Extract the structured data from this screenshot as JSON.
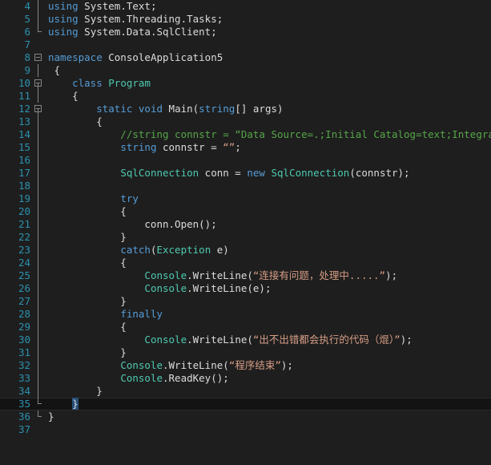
{
  "editor": {
    "name": "visual-studio-code-editor",
    "theme": "dark",
    "background_color": "#1e1e1e",
    "line_number_color": "#2b91af",
    "current_line": 35,
    "current_line_bg": "#131313",
    "selection_color": "#264f78",
    "colors": {
      "keyword": "#569cd6",
      "type": "#4ec9b0",
      "string": "#d69d85",
      "comment": "#57a64a",
      "plain": "#dcdcdc",
      "fold_marker": "#868686"
    },
    "lines": [
      {
        "number": "4",
        "fold": "guide",
        "tokens": [
          {
            "t": "using",
            "c": "kw"
          },
          {
            "t": " System.Text;",
            "c": "txt"
          }
        ]
      },
      {
        "number": "5",
        "fold": "guide",
        "tokens": [
          {
            "t": "using",
            "c": "kw"
          },
          {
            "t": " System.Threading.Tasks;",
            "c": "txt"
          }
        ]
      },
      {
        "number": "6",
        "fold": "guide-end",
        "tokens": [
          {
            "t": "using",
            "c": "kw"
          },
          {
            "t": " System.Data.SqlClient;",
            "c": "txt"
          }
        ]
      },
      {
        "number": "7",
        "fold": "none",
        "tokens": []
      },
      {
        "number": "8",
        "fold": "box",
        "tokens": [
          {
            "t": "namespace",
            "c": "kw"
          },
          {
            "t": " ConsoleApplication5",
            "c": "txt"
          }
        ]
      },
      {
        "number": "9",
        "fold": "guide",
        "tokens": [
          {
            "t": " {",
            "c": "txt"
          }
        ]
      },
      {
        "number": "10",
        "fold": "box-guide",
        "tokens": [
          {
            "t": "    ",
            "c": "txt"
          },
          {
            "t": "class",
            "c": "kw"
          },
          {
            "t": " ",
            "c": "txt"
          },
          {
            "t": "Program",
            "c": "type"
          }
        ]
      },
      {
        "number": "11",
        "fold": "guide",
        "tokens": [
          {
            "t": "    {",
            "c": "txt"
          }
        ]
      },
      {
        "number": "12",
        "fold": "box-guide",
        "tokens": [
          {
            "t": "        ",
            "c": "txt"
          },
          {
            "t": "static",
            "c": "kw"
          },
          {
            "t": " ",
            "c": "txt"
          },
          {
            "t": "void",
            "c": "kw"
          },
          {
            "t": " Main(",
            "c": "txt"
          },
          {
            "t": "string",
            "c": "kw"
          },
          {
            "t": "[] args)",
            "c": "txt"
          }
        ]
      },
      {
        "number": "13",
        "fold": "guide",
        "tokens": [
          {
            "t": "        {",
            "c": "txt"
          }
        ]
      },
      {
        "number": "14",
        "fold": "guide",
        "tokens": [
          {
            "t": "            //string connstr = “Data Source=.;Initial Catalog=text;Integrated Se",
            "c": "cmt"
          }
        ]
      },
      {
        "number": "15",
        "fold": "guide",
        "tokens": [
          {
            "t": "            ",
            "c": "txt"
          },
          {
            "t": "string",
            "c": "kw"
          },
          {
            "t": " connstr = ",
            "c": "txt"
          },
          {
            "t": "“”",
            "c": "str"
          },
          {
            "t": ";",
            "c": "txt"
          }
        ]
      },
      {
        "number": "16",
        "fold": "guide",
        "tokens": []
      },
      {
        "number": "17",
        "fold": "guide",
        "tokens": [
          {
            "t": "            ",
            "c": "txt"
          },
          {
            "t": "SqlConnection",
            "c": "type"
          },
          {
            "t": " conn = ",
            "c": "txt"
          },
          {
            "t": "new",
            "c": "kw"
          },
          {
            "t": " ",
            "c": "txt"
          },
          {
            "t": "SqlConnection",
            "c": "type"
          },
          {
            "t": "(connstr);",
            "c": "txt"
          }
        ]
      },
      {
        "number": "18",
        "fold": "guide",
        "tokens": []
      },
      {
        "number": "19",
        "fold": "guide",
        "tokens": [
          {
            "t": "            ",
            "c": "txt"
          },
          {
            "t": "try",
            "c": "kw"
          }
        ]
      },
      {
        "number": "20",
        "fold": "guide",
        "tokens": [
          {
            "t": "            {",
            "c": "txt"
          }
        ]
      },
      {
        "number": "21",
        "fold": "guide",
        "tokens": [
          {
            "t": "                conn.Open();",
            "c": "txt"
          }
        ]
      },
      {
        "number": "22",
        "fold": "guide",
        "tokens": [
          {
            "t": "            }",
            "c": "txt"
          }
        ]
      },
      {
        "number": "23",
        "fold": "guide",
        "tokens": [
          {
            "t": "            ",
            "c": "txt"
          },
          {
            "t": "catch",
            "c": "kw"
          },
          {
            "t": "(",
            "c": "txt"
          },
          {
            "t": "Exception",
            "c": "type"
          },
          {
            "t": " e)",
            "c": "txt"
          }
        ]
      },
      {
        "number": "24",
        "fold": "guide",
        "tokens": [
          {
            "t": "            {",
            "c": "txt"
          }
        ]
      },
      {
        "number": "25",
        "fold": "guide",
        "tokens": [
          {
            "t": "                ",
            "c": "txt"
          },
          {
            "t": "Console",
            "c": "type"
          },
          {
            "t": ".WriteLine(",
            "c": "txt"
          },
          {
            "t": "“连接有问题，处理中.....”",
            "c": "str"
          },
          {
            "t": ");",
            "c": "txt"
          }
        ]
      },
      {
        "number": "26",
        "fold": "guide",
        "tokens": [
          {
            "t": "                ",
            "c": "txt"
          },
          {
            "t": "Console",
            "c": "type"
          },
          {
            "t": ".WriteLine(e);",
            "c": "txt"
          }
        ]
      },
      {
        "number": "27",
        "fold": "guide",
        "tokens": [
          {
            "t": "            }",
            "c": "txt"
          }
        ]
      },
      {
        "number": "28",
        "fold": "guide",
        "tokens": [
          {
            "t": "            ",
            "c": "txt"
          },
          {
            "t": "finally",
            "c": "kw"
          }
        ]
      },
      {
        "number": "29",
        "fold": "guide",
        "tokens": [
          {
            "t": "            {",
            "c": "txt"
          }
        ]
      },
      {
        "number": "30",
        "fold": "guide",
        "tokens": [
          {
            "t": "                ",
            "c": "txt"
          },
          {
            "t": "Console",
            "c": "type"
          },
          {
            "t": ".WriteLine(",
            "c": "txt"
          },
          {
            "t": "“出不出错都会执行的代码（焜）”",
            "c": "str"
          },
          {
            "t": ");",
            "c": "txt"
          }
        ]
      },
      {
        "number": "31",
        "fold": "guide",
        "tokens": [
          {
            "t": "            }",
            "c": "txt"
          }
        ]
      },
      {
        "number": "32",
        "fold": "guide",
        "tokens": [
          {
            "t": "            ",
            "c": "txt"
          },
          {
            "t": "Console",
            "c": "type"
          },
          {
            "t": ".WriteLine(",
            "c": "txt"
          },
          {
            "t": "“程序结束”",
            "c": "str"
          },
          {
            "t": ");",
            "c": "txt"
          }
        ]
      },
      {
        "number": "33",
        "fold": "guide",
        "tokens": [
          {
            "t": "            ",
            "c": "txt"
          },
          {
            "t": "Console",
            "c": "type"
          },
          {
            "t": ".ReadKey();",
            "c": "txt"
          }
        ]
      },
      {
        "number": "34",
        "fold": "guide",
        "tokens": [
          {
            "t": "        }",
            "c": "txt"
          }
        ]
      },
      {
        "number": "35",
        "fold": "guide-end",
        "current": true,
        "tokens": [
          {
            "t": "    ",
            "c": "txt"
          },
          {
            "t": "}",
            "c": "sel"
          }
        ]
      },
      {
        "number": "36",
        "fold": "guide-end",
        "tokens": [
          {
            "t": "}",
            "c": "txt"
          }
        ]
      },
      {
        "number": "37",
        "fold": "none",
        "tokens": []
      }
    ]
  }
}
